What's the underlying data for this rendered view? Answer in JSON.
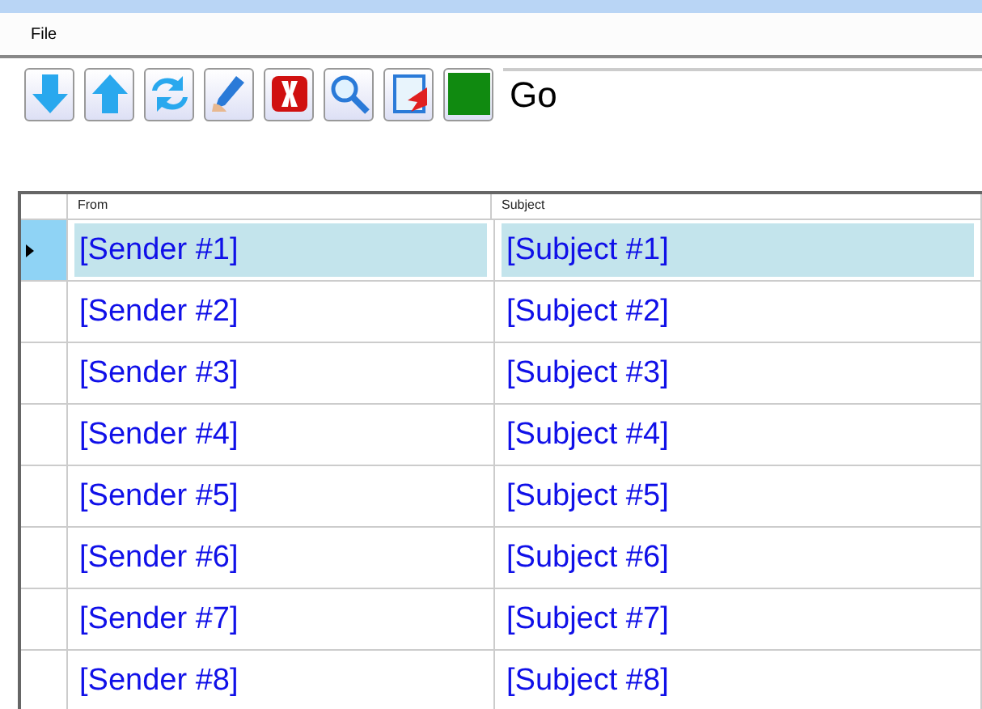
{
  "menu": [
    "File"
  ],
  "toolbar": {
    "go_field": {
      "value": "Go"
    }
  },
  "table": {
    "columns": [
      "From",
      "Subject"
    ],
    "rows": [
      {
        "from": "[Sender #1]",
        "subject": "[Subject #1]",
        "selected": true
      },
      {
        "from": "[Sender #2]",
        "subject": "[Subject #2]",
        "selected": false
      },
      {
        "from": "[Sender #3]",
        "subject": "[Subject #3]",
        "selected": false
      },
      {
        "from": "[Sender #4]",
        "subject": "[Subject #4]",
        "selected": false
      },
      {
        "from": "[Sender #5]",
        "subject": "[Subject #5]",
        "selected": false
      },
      {
        "from": "[Sender #6]",
        "subject": "[Subject #6]",
        "selected": false
      },
      {
        "from": "[Sender #7]",
        "subject": "[Subject #7]",
        "selected": false
      },
      {
        "from": "[Sender #8]",
        "subject": "[Subject #8]",
        "selected": false
      }
    ]
  }
}
